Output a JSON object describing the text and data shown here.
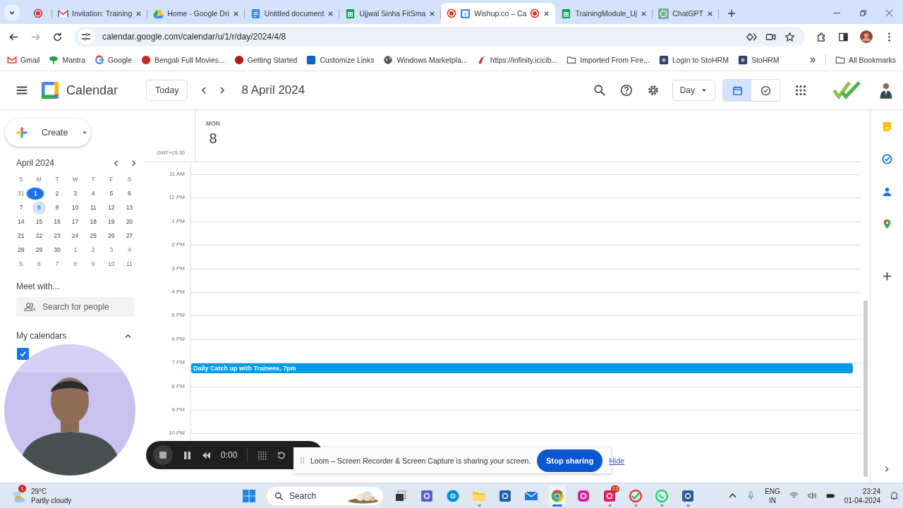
{
  "browser": {
    "tabs": [
      {
        "kind": "none",
        "recording": true,
        "selected": false
      },
      {
        "label": "Invitation: Training",
        "kind": "mail",
        "recording": false,
        "selected": false
      },
      {
        "label": "Home - Google Dri",
        "kind": "drive",
        "recording": false,
        "selected": false
      },
      {
        "label": "Untitled document",
        "kind": "doc",
        "recording": false,
        "selected": false
      },
      {
        "label": "Ujjwal Sinha FitSma",
        "kind": "sheet",
        "recording": false,
        "selected": false
      },
      {
        "label": "Wishup.co – Ca",
        "kind": "calendar",
        "recording": true,
        "selected": true
      },
      {
        "label": "TrainingModule_Uj",
        "kind": "sheet",
        "recording": false,
        "selected": false
      },
      {
        "label": "ChatGPT",
        "kind": "chat",
        "recording": false,
        "selected": false
      }
    ],
    "address": "calendar.google.com/calendar/u/1/r/day/2024/4/8",
    "bookmarks": [
      {
        "label": "Gmail",
        "kind": "mail"
      },
      {
        "label": "Mantra",
        "kind": "leaf"
      },
      {
        "label": "Google",
        "kind": "ring"
      },
      {
        "label": "Bengali Full Movies...",
        "kind": "red-circle"
      },
      {
        "label": "Getting Started",
        "kind": "red-blob"
      },
      {
        "label": "Customize Links",
        "kind": "blue-square"
      },
      {
        "label": "Windows Marketpla...",
        "kind": "globe"
      },
      {
        "label": "https://infinity.icicib...",
        "kind": "swoosh"
      },
      {
        "label": "Imported From Fire...",
        "kind": "folder"
      },
      {
        "label": "Login to StoHRM",
        "kind": "badge"
      },
      {
        "label": "StoHRM",
        "kind": "badge"
      }
    ],
    "all_bookmarks": "All Bookmarks"
  },
  "header": {
    "app_name": "Calendar",
    "today_button": "Today",
    "date_title": "8 April 2024",
    "view_selector": "Day",
    "view_toggle": [
      {
        "kind": "calendar",
        "selected": true
      },
      {
        "kind": "tasks",
        "selected": false
      }
    ]
  },
  "sidebar": {
    "create_button": "Create",
    "mini_calendar": {
      "title": "April 2024",
      "weekdays": [
        "S",
        "M",
        "T",
        "W",
        "T",
        "F",
        "S"
      ],
      "weeks": [
        [
          {
            "label": "31",
            "kind": "outside"
          },
          {
            "label": "1",
            "kind": "today"
          },
          {
            "label": "2",
            "kind": "day"
          },
          {
            "label": "3",
            "kind": "day"
          },
          {
            "label": "4",
            "kind": "day"
          },
          {
            "label": "5",
            "kind": "day"
          },
          {
            "label": "6",
            "kind": "day"
          }
        ],
        [
          {
            "label": "7",
            "kind": "day"
          },
          {
            "label": "8",
            "kind": "selected"
          },
          {
            "label": "9",
            "kind": "day"
          },
          {
            "label": "10",
            "kind": "day"
          },
          {
            "label": "11",
            "kind": "day"
          },
          {
            "label": "12",
            "kind": "day"
          },
          {
            "label": "13",
            "kind": "day"
          }
        ],
        [
          {
            "label": "14",
            "kind": "day"
          },
          {
            "label": "15",
            "kind": "day"
          },
          {
            "label": "16",
            "kind": "day"
          },
          {
            "label": "17",
            "kind": "day"
          },
          {
            "label": "18",
            "kind": "day"
          },
          {
            "label": "19",
            "kind": "day"
          },
          {
            "label": "20",
            "kind": "day"
          }
        ],
        [
          {
            "label": "21",
            "kind": "day"
          },
          {
            "label": "22",
            "kind": "day"
          },
          {
            "label": "23",
            "kind": "day"
          },
          {
            "label": "24",
            "kind": "day"
          },
          {
            "label": "25",
            "kind": "day"
          },
          {
            "label": "26",
            "kind": "day"
          },
          {
            "label": "27",
            "kind": "day"
          }
        ],
        [
          {
            "label": "28",
            "kind": "day"
          },
          {
            "label": "29",
            "kind": "day"
          },
          {
            "label": "30",
            "kind": "day"
          },
          {
            "label": "1",
            "kind": "outside"
          },
          {
            "label": "2",
            "kind": "outside"
          },
          {
            "label": "3",
            "kind": "outside"
          },
          {
            "label": "4",
            "kind": "outside"
          }
        ],
        [
          {
            "label": "5",
            "kind": "outside"
          },
          {
            "label": "6",
            "kind": "outside"
          },
          {
            "label": "7",
            "kind": "outside"
          },
          {
            "label": "8",
            "kind": "outside"
          },
          {
            "label": "9",
            "kind": "outside"
          },
          {
            "label": "10",
            "kind": "outside"
          },
          {
            "label": "11",
            "kind": "outside"
          }
        ]
      ]
    },
    "meet_heading": "Meet with...",
    "people_search": {
      "placeholder": "Search for people"
    },
    "my_calendars": {
      "heading": "My calendars",
      "expanded": true,
      "items": [
        {
          "checked": true,
          "color": "#1a73e8"
        }
      ]
    }
  },
  "day_view": {
    "weekday": "MON",
    "day": "8",
    "timezone": "GMT+05:30",
    "hours": [
      {
        "label": "11 AM"
      },
      {
        "label": "12 PM"
      },
      {
        "label": "1 PM"
      },
      {
        "label": "2 PM"
      },
      {
        "label": "3 PM"
      },
      {
        "label": "4 PM"
      },
      {
        "label": "5 PM"
      },
      {
        "label": "6 PM"
      },
      {
        "label": "7 PM",
        "events": [
          {
            "title": "Daily Catch up with Trainees, 7pm",
            "color": "#039be5"
          }
        ]
      },
      {
        "label": "8 PM"
      },
      {
        "label": "9 PM"
      },
      {
        "label": "10 PM"
      }
    ]
  },
  "recorder": {
    "timer": "0:00",
    "notice": "Loom – Screen Recorder & Screen Capture is sharing your screen.",
    "stop_button": "Stop sharing",
    "hide_link": "Hide"
  },
  "taskbar": {
    "weather": {
      "temperature": "29°C",
      "condition": "Partly cloudy",
      "badge": "1"
    },
    "search": {
      "placeholder": "Search"
    },
    "apps": [
      {
        "kind": "windows",
        "running": false,
        "active": false
      },
      {
        "kind": "taskview",
        "running": false,
        "active": false
      },
      {
        "kind": "teams",
        "running": false,
        "active": false
      },
      {
        "kind": "edge",
        "running": false,
        "active": false
      },
      {
        "kind": "files",
        "running": true,
        "active": false
      },
      {
        "kind": "store",
        "running": false,
        "active": false
      },
      {
        "kind": "mail",
        "running": false,
        "active": false
      },
      {
        "kind": "chrome",
        "running": true,
        "active": true
      },
      {
        "kind": "instagram",
        "running": false,
        "active": false
      },
      {
        "kind": "slack",
        "running": true,
        "active": false,
        "badge": "13"
      },
      {
        "kind": "check",
        "running": true,
        "active": false
      },
      {
        "kind": "whatsapp",
        "running": true,
        "active": false
      },
      {
        "kind": "word",
        "running": true,
        "active": false
      }
    ],
    "language": "ENG",
    "region": "IN",
    "time": "23:24",
    "date": "01-04-2024"
  }
}
